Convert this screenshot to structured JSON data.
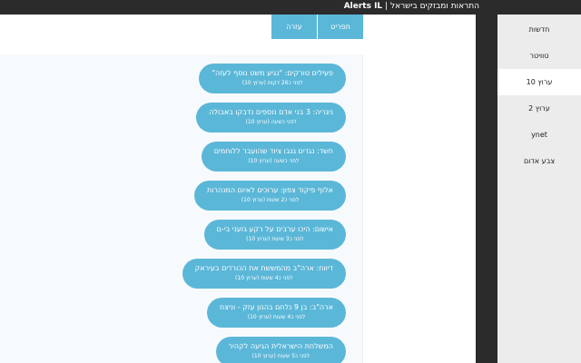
{
  "window": {
    "brand": "Alerts IL",
    "separator": "|",
    "subtitle": "התראות ומבזקים בישראל"
  },
  "tabs": [
    {
      "label": "תפריט"
    },
    {
      "label": "עזרה"
    }
  ],
  "sidebar": {
    "items": [
      {
        "label": "חדשות"
      },
      {
        "label": "טוויטר"
      },
      {
        "label": "ערוץ 10"
      },
      {
        "label": "ערוץ 2"
      },
      {
        "label": "ynet"
      },
      {
        "label": "צבע אדום"
      }
    ],
    "active_index": 2
  },
  "feed": {
    "items": [
      {
        "title": "פעילים טורקים: \"נגיע משט נוסף לעזה\"",
        "meta": "לפני כ26 דקות (ערוץ 10)"
      },
      {
        "title": "ניגריה: 3 בני אדם נוספים נדבקו באבולה",
        "meta": "לפני כשעה (ערוץ 10)"
      },
      {
        "title": "חשד: נגדים גנבו ציוד שהועבר ללוחמים",
        "meta": "לפני כשעה (ערוץ 10)"
      },
      {
        "title": "אלוף פיקוד צפון: ערוכים לאיום המנהרות",
        "meta": "לפני כ2 שעות (ערוץ 10)"
      },
      {
        "title": "אישום: היכו ערבים על רקע גזעני בי-ם",
        "meta": "לפני כ3 שעות (ערוץ 10)"
      },
      {
        "title": "דיווח: ארה\"ב מהמששת את הכורדים בעיראק",
        "meta": "לפני כ4 שעות (ערוץ 10)"
      },
      {
        "title": "ארה\"ב: בן 9 נלחם בהנון עזק - וניצח",
        "meta": "לפני כ4 שעות (ערוץ 10)"
      },
      {
        "title": "המשלחת הישראלית הגיעה לקהיר",
        "meta": "לפני כ5 שעות (ערוץ 10)"
      }
    ]
  },
  "colors": {
    "accent": "#5bb7d8",
    "topbar": "#2b2b2b",
    "sidebar_bg": "#ececec",
    "feed_bg": "#f7fafc"
  }
}
